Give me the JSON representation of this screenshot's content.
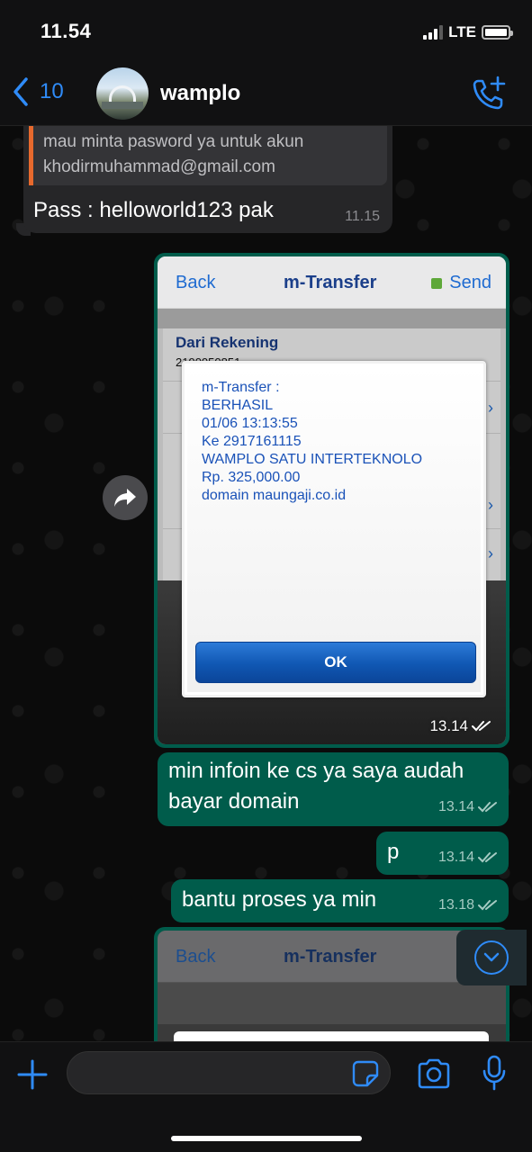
{
  "status": {
    "time": "11.54",
    "network": "LTE"
  },
  "header": {
    "back_count": "10",
    "contact_name": "wamplo"
  },
  "messages": {
    "incoming": {
      "quote": "mau minta pasword ya untuk akun\nkhodirmuhammad@gmail.com",
      "text": "Pass : helloworld123 pak",
      "time": "11.15"
    },
    "image1": {
      "nav_back": "Back",
      "nav_title": "m-Transfer",
      "nav_send": "Send",
      "field_label": "Dari Rekening",
      "field_value": "2190050851",
      "dialog_text": "m-Transfer :\nBERHASIL\n01/06 13:13:55\nKe 2917161115\nWAMPLO SATU INTERTEKNOLO\nRp. 325,000.00\ndomain maungaji.co.id",
      "ok_label": "OK",
      "time": "13.14"
    },
    "out1": {
      "text": "min infoin ke cs ya saya audah bayar domain",
      "time": "13.14"
    },
    "out2": {
      "text": "p",
      "time": "13.14"
    },
    "out3": {
      "text": "bantu proses ya min",
      "time": "13.18"
    },
    "image2": {
      "nav_back": "Back",
      "nav_title": "m-Transfer"
    }
  },
  "input": {
    "placeholder": ""
  },
  "colors": {
    "accent": "#2f8bf7",
    "outgoing_bubble": "#005c4b",
    "incoming_bubble": "#262628",
    "quote_bar": "#e7692d"
  }
}
